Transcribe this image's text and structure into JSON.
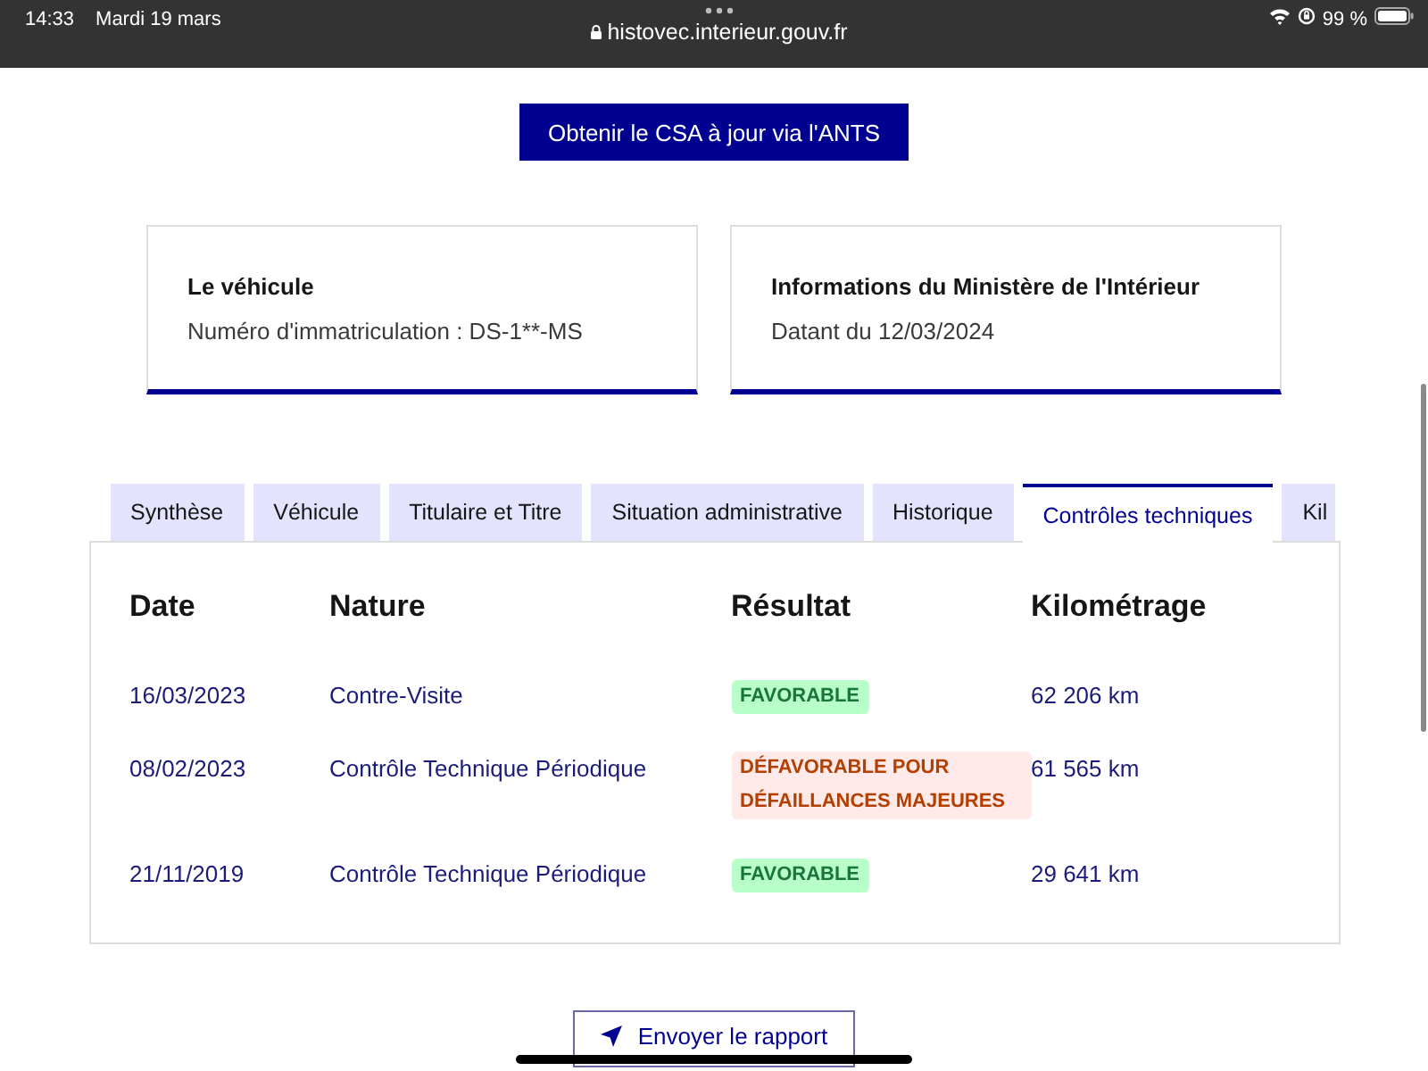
{
  "status_bar": {
    "time": "14:33",
    "date": "Mardi 19 mars",
    "url": "histovec.interieur.gouv.fr",
    "battery": "99 %"
  },
  "csa_button": {
    "label": "Obtenir le CSA à jour via l'ANTS"
  },
  "cards": [
    {
      "title": "Le véhicule",
      "text": "Numéro d'immatriculation : DS-1**-MS"
    },
    {
      "title": "Informations du Ministère de l'Intérieur",
      "text": "Datant du 12/03/2024"
    }
  ],
  "tabs": [
    {
      "label": "Synthèse",
      "selected": false
    },
    {
      "label": "Véhicule",
      "selected": false
    },
    {
      "label": "Titulaire et Titre",
      "selected": false
    },
    {
      "label": "Situation administrative",
      "selected": false
    },
    {
      "label": "Historique",
      "selected": false
    },
    {
      "label": "Contrôles techniques",
      "selected": true
    },
    {
      "label": "Kil",
      "selected": false
    }
  ],
  "table": {
    "columns": [
      "Date",
      "Nature",
      "Résultat",
      "Kilométrage"
    ],
    "rows": [
      {
        "date": "16/03/2023",
        "nature": "Contre-Visite",
        "result": {
          "label": "FAVORABLE",
          "kind": "success"
        },
        "mileage": "62 206 km"
      },
      {
        "date": "08/02/2023",
        "nature": "Contrôle Technique Périodique",
        "result": {
          "label": "DÉFAVORABLE POUR DÉFAILLANCES MAJEURES",
          "kind": "error"
        },
        "mileage": "61 565 km"
      },
      {
        "date": "21/11/2019",
        "nature": "Contrôle Technique Périodique",
        "result": {
          "label": "FAVORABLE",
          "kind": "success"
        },
        "mileage": "29 641 km"
      }
    ]
  },
  "report_button": {
    "label": "Envoyer le rapport"
  }
}
